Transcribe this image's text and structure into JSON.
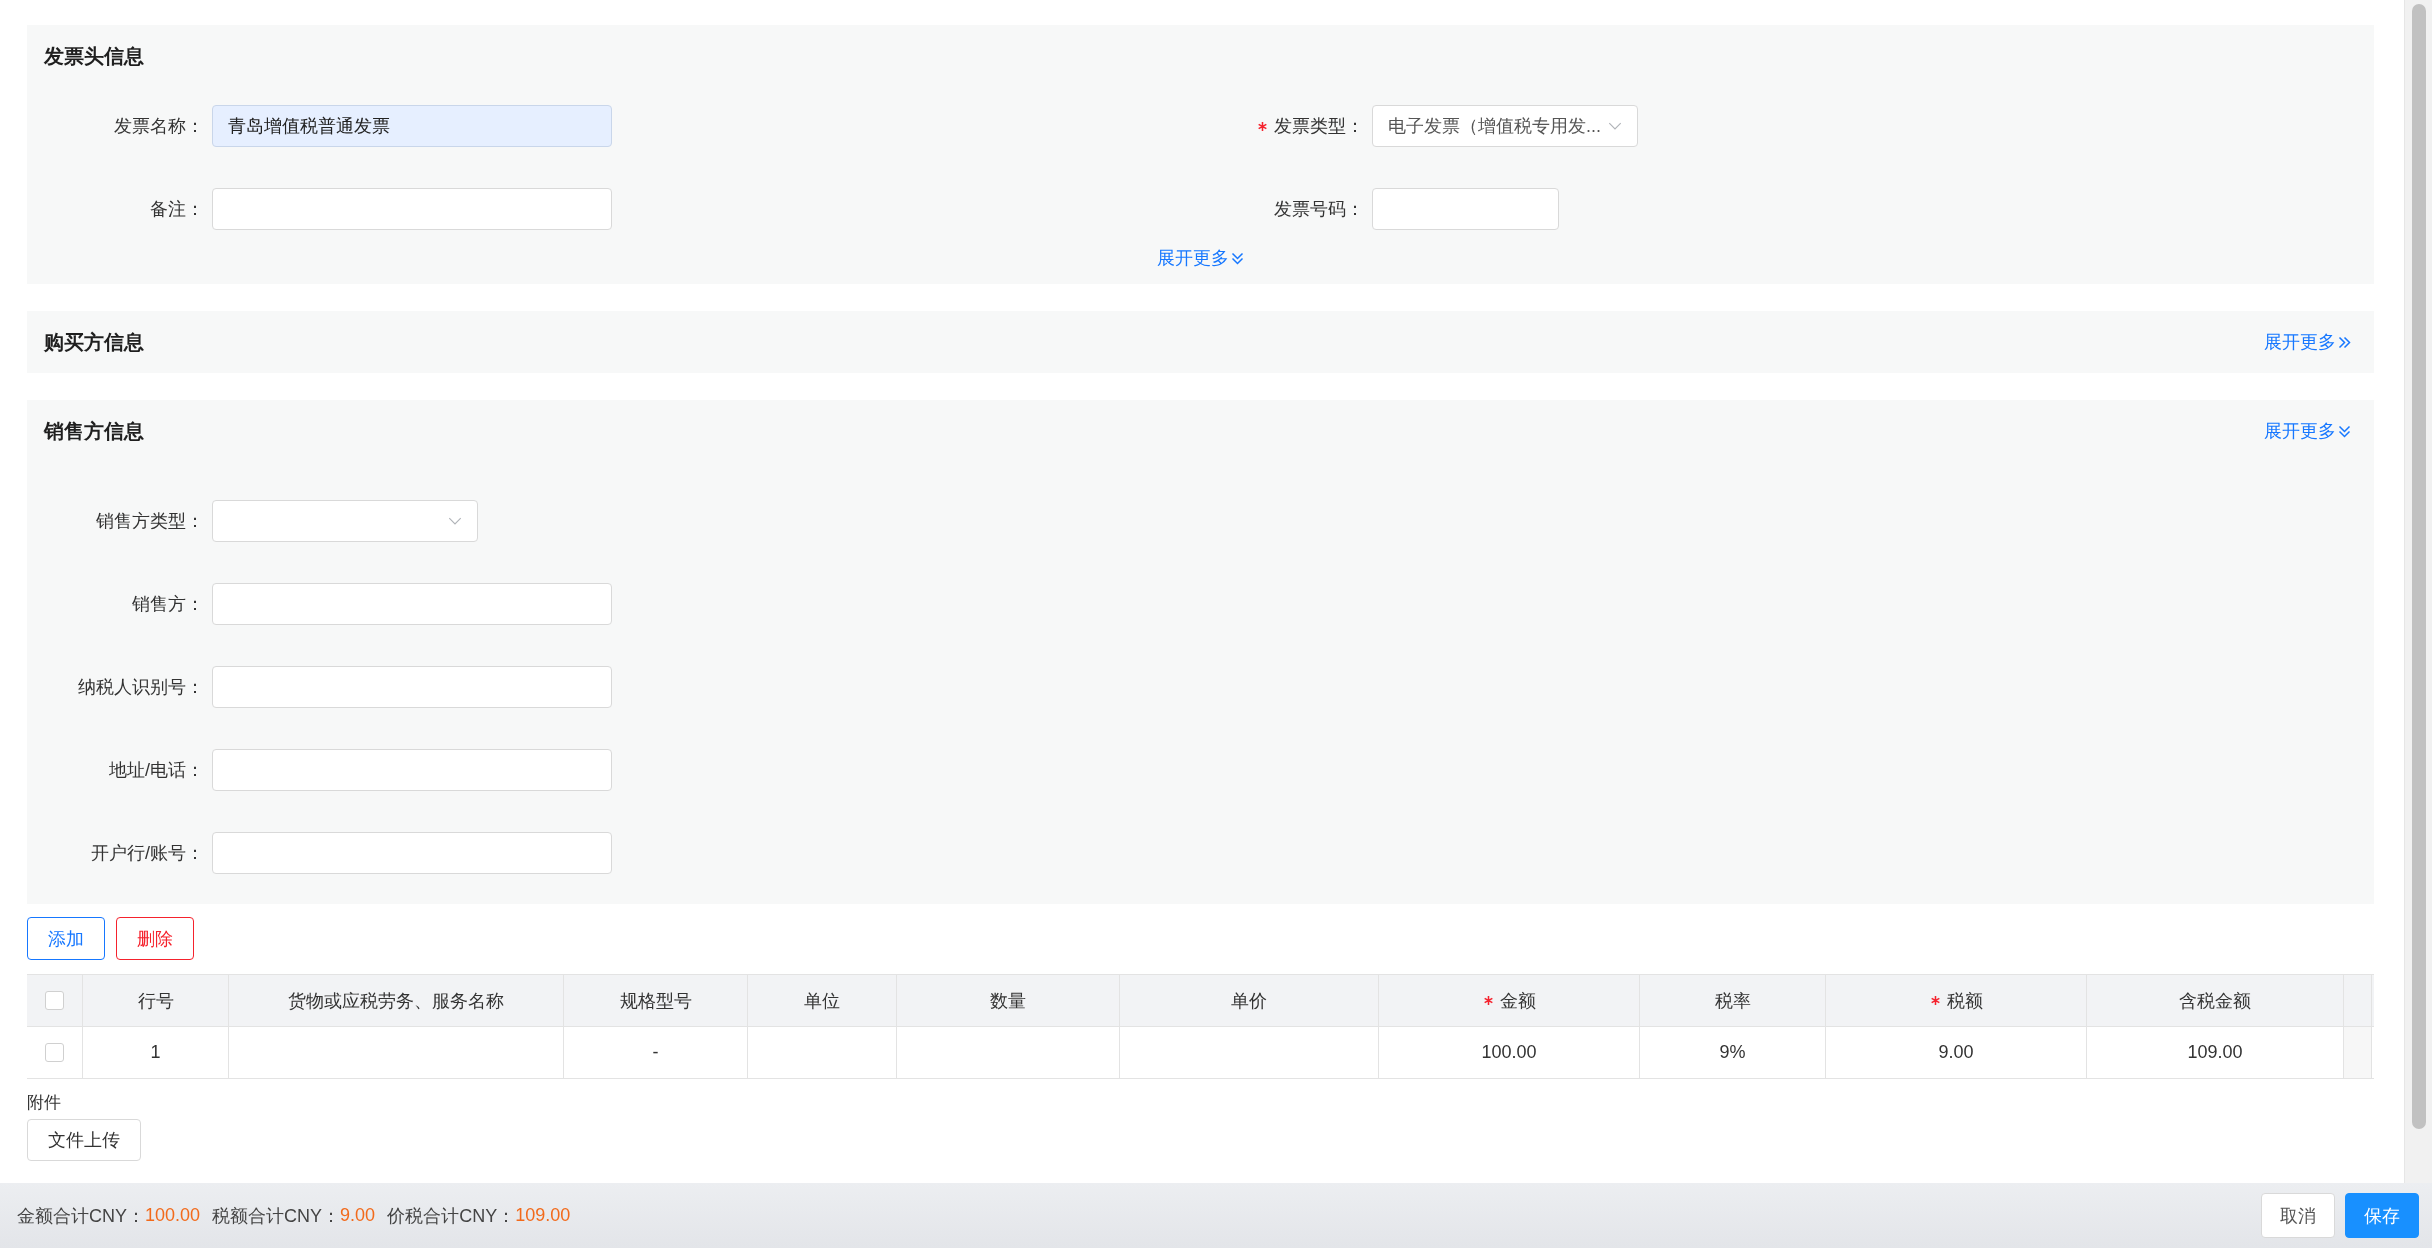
{
  "sections": [
    {
      "title": "发票头信息",
      "kind": "grid",
      "expanded": true,
      "link": "展开更多",
      "fields": [
        {
          "label": "发票名称：",
          "required": false,
          "kind": "input",
          "value": "青岛增值税普通发票",
          "highlighted": true
        },
        {
          "label": "发票类型：",
          "required": true,
          "kind": "select",
          "value": "电子发票（增值税专用发...",
          "highlighted": false
        },
        {
          "label": "备注：",
          "required": false,
          "kind": "input",
          "highlighted": false
        },
        {
          "label": "发票号码：",
          "required": false,
          "kind": "short-input",
          "highlighted": false
        }
      ]
    },
    {
      "title": "购买方信息",
      "kind": "list",
      "expanded": false,
      "link": "展开更多"
    },
    {
      "title": "销售方信息",
      "kind": "list",
      "expanded": true,
      "link": "展开更多",
      "fields": [
        {
          "label": "销售方类型：",
          "required": false,
          "kind": "select",
          "highlighted": false
        },
        {
          "label": "销售方：",
          "required": false,
          "kind": "input",
          "highlighted": false
        },
        {
          "label": "纳税人识别号：",
          "required": false,
          "kind": "input",
          "highlighted": false
        },
        {
          "label": "地址/电话：",
          "required": false,
          "kind": "input",
          "highlighted": false
        },
        {
          "label": "开户行/账号：",
          "required": false,
          "kind": "input",
          "highlighted": false
        }
      ]
    }
  ],
  "actions": [
    {
      "label": "添加",
      "kind": "primary"
    },
    {
      "label": "删除",
      "kind": "danger"
    }
  ],
  "table": {
    "select_all_checked": false,
    "columns": [
      {
        "label": "行号",
        "required": false
      },
      {
        "label": "货物或应税劳务、服务名称",
        "required": false
      },
      {
        "label": "规格型号",
        "required": false
      },
      {
        "label": "单位",
        "required": false
      },
      {
        "label": "数量",
        "required": false
      },
      {
        "label": "单价",
        "required": false
      },
      {
        "label": "金额",
        "required": true
      },
      {
        "label": "税率",
        "required": false
      },
      {
        "label": "税额",
        "required": true
      },
      {
        "label": "含税金额",
        "required": false
      }
    ],
    "rows": [
      {
        "checked": false,
        "cells": [
          "1",
          "",
          "-",
          "",
          "",
          "",
          "100.00",
          "9%",
          "9.00",
          "109.00"
        ]
      }
    ]
  },
  "attachment": {
    "label": "附件",
    "button": "文件上传"
  },
  "totals": [
    {
      "label": "金额合计CNY：",
      "value": "100.00"
    },
    {
      "label": "税额合计CNY：",
      "value": "9.00"
    },
    {
      "label": "价税合计CNY：",
      "value": "109.00"
    }
  ],
  "footer_buttons": [
    {
      "label": "取消",
      "kind": "default"
    },
    {
      "label": "保存",
      "kind": "primary"
    }
  ]
}
